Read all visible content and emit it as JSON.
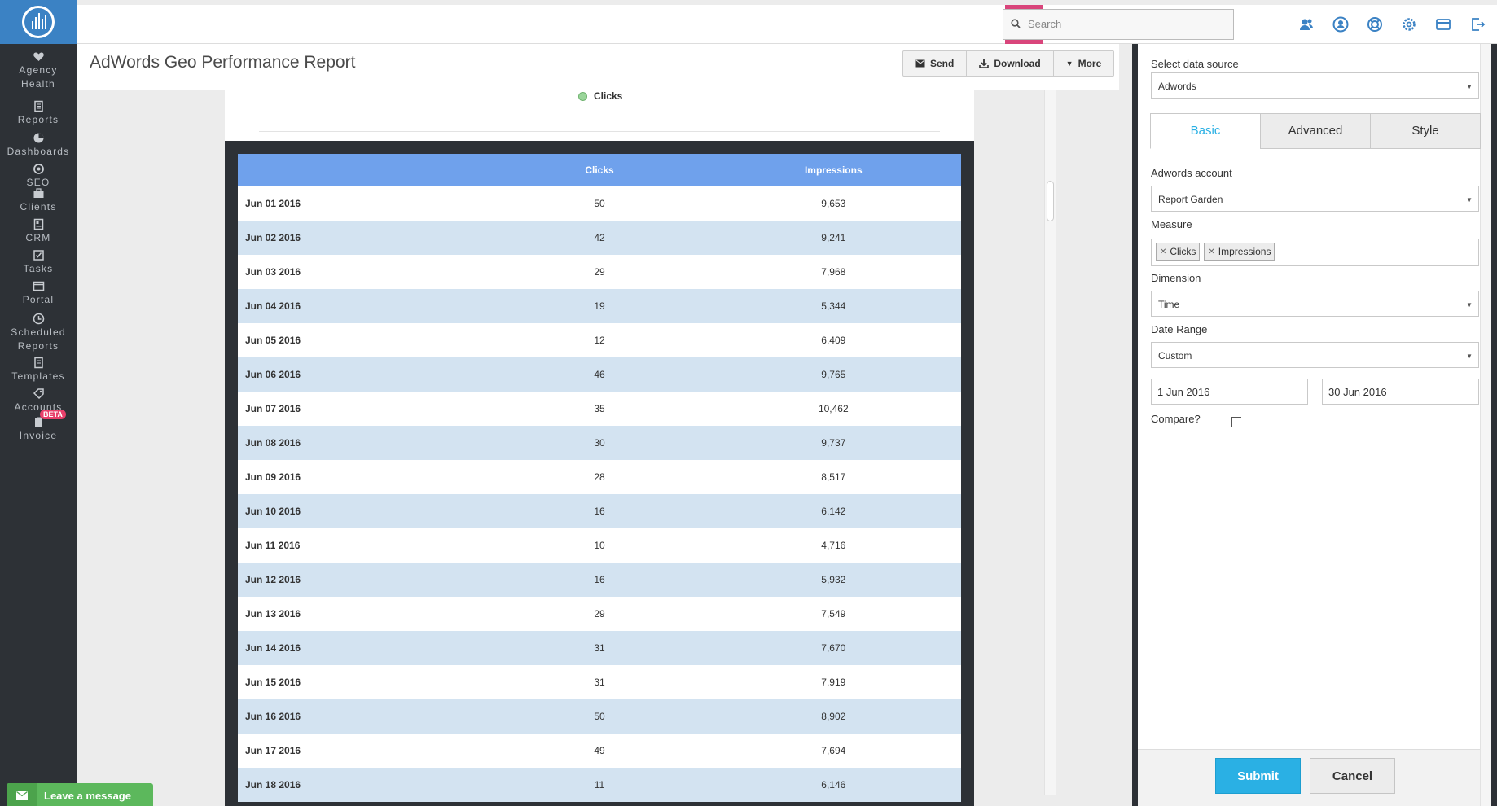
{
  "sidebar": {
    "items": [
      {
        "label": "Agency Health",
        "icon": "heart-icon"
      },
      {
        "label": "Reports",
        "icon": "report-icon"
      },
      {
        "label": "Dashboards",
        "icon": "pie-chart-icon"
      },
      {
        "label": "SEO",
        "icon": "target-icon"
      },
      {
        "label": "Clients",
        "icon": "briefcase-icon"
      },
      {
        "label": "CRM",
        "icon": "crm-icon"
      },
      {
        "label": "Tasks",
        "icon": "checkbox-icon"
      },
      {
        "label": "Portal",
        "icon": "portal-icon"
      },
      {
        "label": "Scheduled Reports",
        "icon": "clock-icon"
      },
      {
        "label": "Templates",
        "icon": "template-icon"
      },
      {
        "label": "Accounts",
        "icon": "accounts-icon"
      },
      {
        "label": "Invoice",
        "icon": "invoice-icon"
      }
    ],
    "beta_badge": "BETA"
  },
  "topbar": {
    "plus_label": "+",
    "search_placeholder": "Search",
    "icons": [
      "users-icon",
      "user-circle-icon",
      "help-ring-icon",
      "gear-icon",
      "credit-card-icon",
      "logout-icon"
    ]
  },
  "header": {
    "title": "AdWords Geo Performance Report",
    "send_label": "Send",
    "download_label": "Download",
    "more_label": "More"
  },
  "chart_legend": "Clicks",
  "table": {
    "headers": [
      "",
      "Clicks",
      "Impressions"
    ],
    "rows": [
      [
        "Jun 01 2016",
        "50",
        "9,653"
      ],
      [
        "Jun 02 2016",
        "42",
        "9,241"
      ],
      [
        "Jun 03 2016",
        "29",
        "7,968"
      ],
      [
        "Jun 04 2016",
        "19",
        "5,344"
      ],
      [
        "Jun 05 2016",
        "12",
        "6,409"
      ],
      [
        "Jun 06 2016",
        "46",
        "9,765"
      ],
      [
        "Jun 07 2016",
        "35",
        "10,462"
      ],
      [
        "Jun 08 2016",
        "30",
        "9,737"
      ],
      [
        "Jun 09 2016",
        "28",
        "8,517"
      ],
      [
        "Jun 10 2016",
        "16",
        "6,142"
      ],
      [
        "Jun 11 2016",
        "10",
        "4,716"
      ],
      [
        "Jun 12 2016",
        "16",
        "5,932"
      ],
      [
        "Jun 13 2016",
        "29",
        "7,549"
      ],
      [
        "Jun 14 2016",
        "31",
        "7,670"
      ],
      [
        "Jun 15 2016",
        "31",
        "7,919"
      ],
      [
        "Jun 16 2016",
        "50",
        "8,902"
      ],
      [
        "Jun 17 2016",
        "49",
        "7,694"
      ],
      [
        "Jun 18 2016",
        "11",
        "6,146"
      ]
    ]
  },
  "panel": {
    "data_source_label": "Select data source",
    "data_source_value": "Adwords",
    "tabs": [
      "Basic",
      "Advanced",
      "Style"
    ],
    "active_tab": "Basic",
    "account_label": "Adwords account",
    "account_value": "Report Garden",
    "measure_label": "Measure",
    "measures": [
      "Clicks",
      "Impressions"
    ],
    "dimension_label": "Dimension",
    "dimension_value": "Time",
    "date_range_label": "Date Range",
    "date_range_value": "Custom",
    "start_date": "1 Jun 2016",
    "end_date": "30 Jun 2016",
    "compare_label": "Compare?",
    "compare_checked": false,
    "submit_label": "Submit",
    "cancel_label": "Cancel"
  },
  "chat": {
    "label": "Leave a message"
  },
  "colors": {
    "sidebar_bg": "#2d3136",
    "logo_bg": "#3b82c4",
    "accent_pink": "#d9457b",
    "table_header": "#6fa1ec",
    "row_alt": "#d3e3f1",
    "submit_blue": "#2ab0e4",
    "chat_green": "#5cb85c"
  }
}
